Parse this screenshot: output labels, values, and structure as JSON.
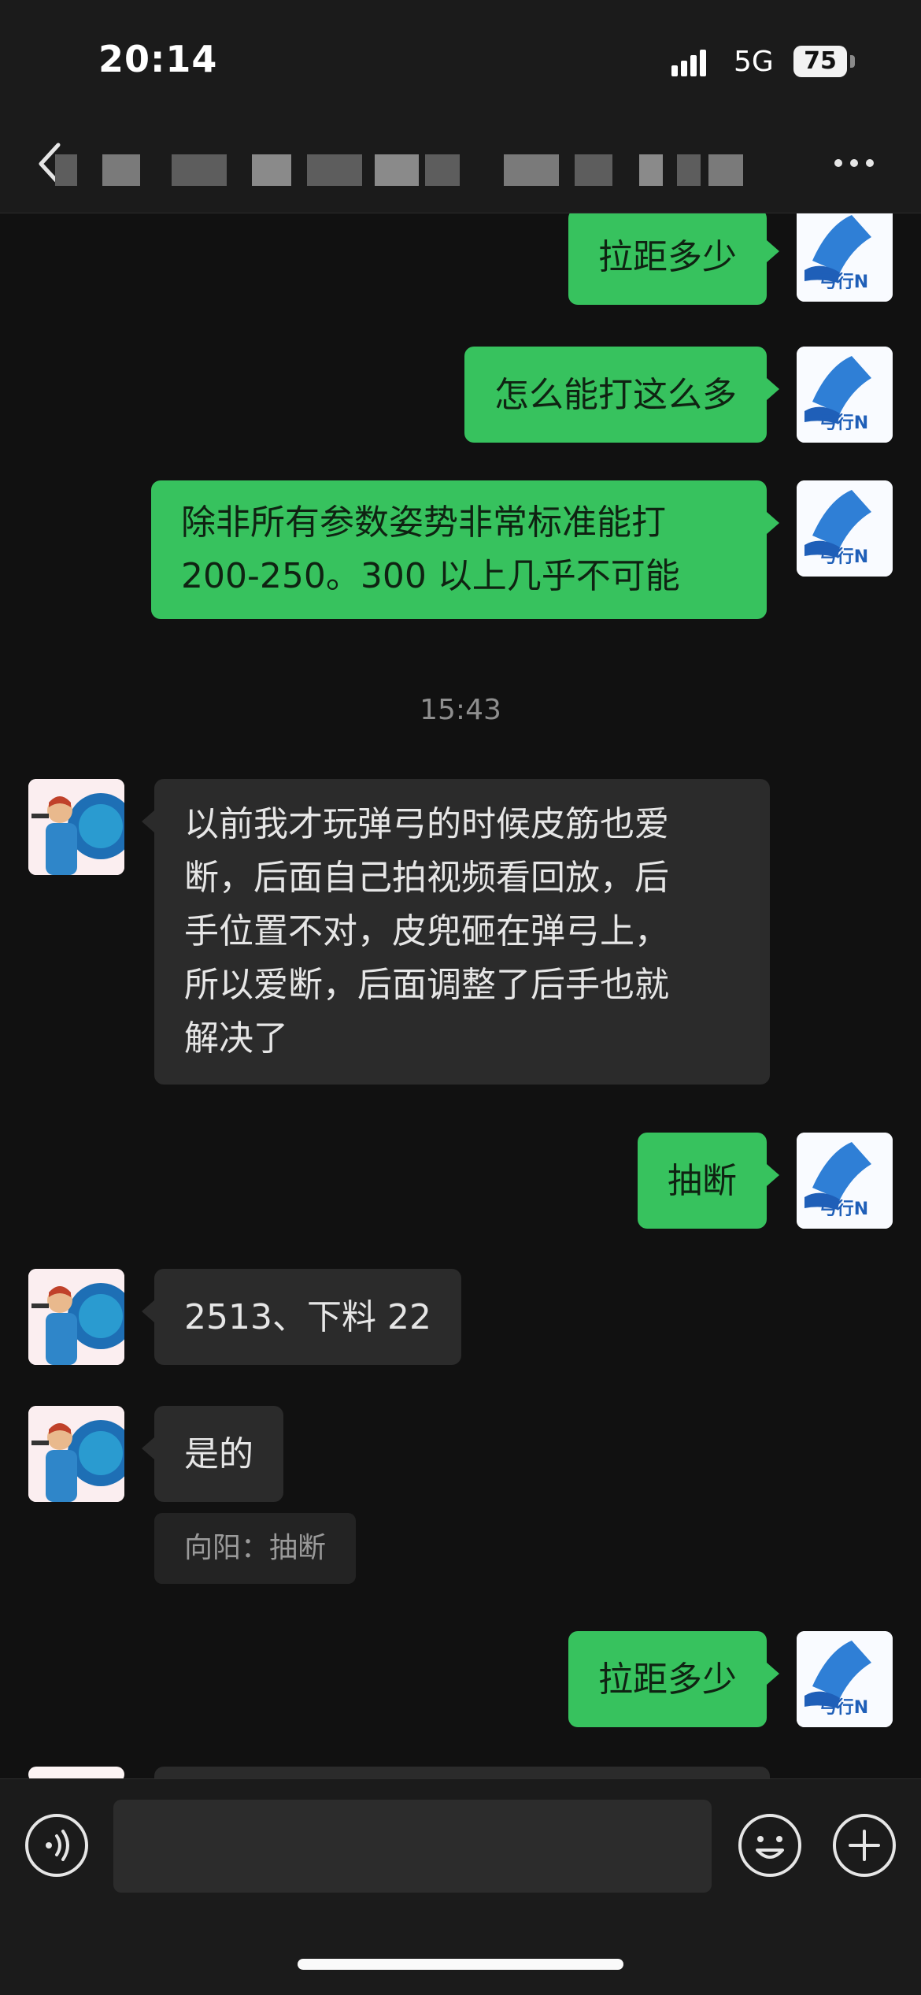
{
  "status_bar": {
    "time": "20:14",
    "network": "5G",
    "battery": "75"
  },
  "header": {
    "back_icon": "chevron-left-icon",
    "more_icon": "more-horizontal-icon"
  },
  "colors": {
    "outgoing_bubble": "#37c25e",
    "incoming_bubble": "#2b2b2b",
    "background": "#111111"
  },
  "chat": {
    "messages": [
      {
        "sender": "me",
        "text": "拉距多少"
      },
      {
        "sender": "me",
        "text": "怎么能打这么多"
      },
      {
        "sender": "me",
        "lines": [
          "除非所有参数姿势非常标准能打",
          "200-250。300 以上几乎不可能"
        ]
      },
      {
        "timestamp": "15:43"
      },
      {
        "sender": "other",
        "lines": [
          "以前我才玩弹弓的时候皮筋也爱",
          "断，后面自己拍视频看回放，后",
          "手位置不对，皮兜砸在弹弓上，",
          "所以爱断，后面调整了后手也就",
          "解决了"
        ]
      },
      {
        "sender": "me",
        "text": "抽断"
      },
      {
        "sender": "other",
        "text": "2513、下料 22"
      },
      {
        "sender": "other",
        "text": "是的",
        "quote": "向阳：抽断"
      },
      {
        "sender": "me",
        "text": "拉距多少"
      }
    ]
  },
  "avatar_right": {
    "logo_text": "弓行N"
  },
  "input_bar": {
    "voice_icon": "voice-icon",
    "emoji_icon": "emoji-icon",
    "plus_icon": "plus-icon"
  }
}
